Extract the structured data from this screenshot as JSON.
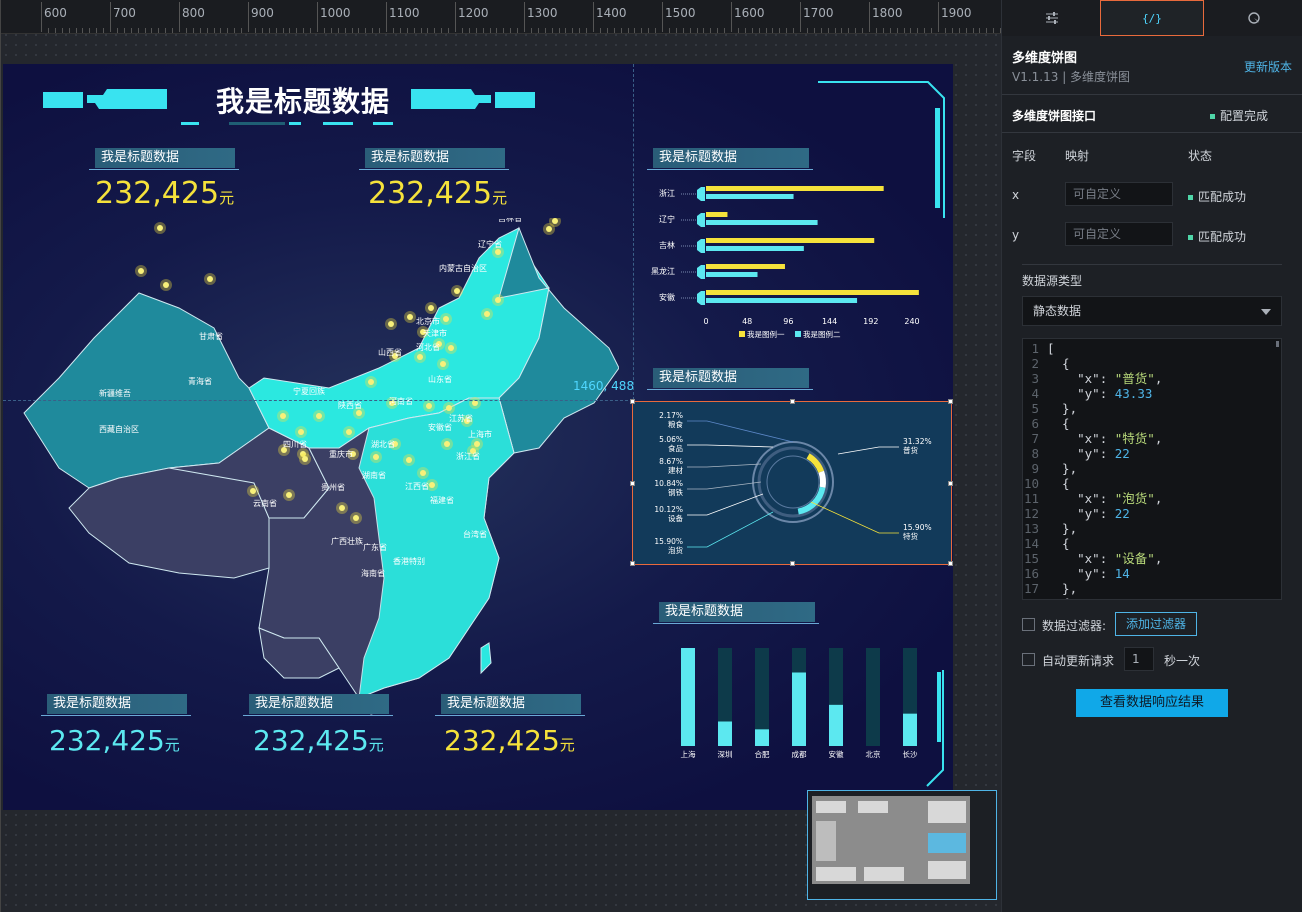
{
  "ruler": {
    "labels": [
      "600",
      "700",
      "800",
      "900",
      "1000",
      "1100",
      "1200",
      "1300",
      "1400",
      "1500",
      "1600",
      "1700",
      "1800",
      "1900"
    ]
  },
  "screen": {
    "main_title": "我是标题数据",
    "cards_top": [
      {
        "title": "我是标题数据",
        "value": "232,425",
        "unit": "元"
      },
      {
        "title": "我是标题数据",
        "value": "232,425",
        "unit": "元"
      }
    ],
    "cards_bottom": [
      {
        "title": "我是标题数据",
        "value": "232,425",
        "unit": "元"
      },
      {
        "title": "我是标题数据",
        "value": "232,425",
        "unit": "元"
      },
      {
        "title": "我是标题数据",
        "value": "232,425",
        "unit": "元"
      }
    ],
    "bar_title": "我是标题数据",
    "pie_title": "我是标题数据",
    "column_title": "我是标题数据",
    "coord_readout": "1460, 488",
    "map_labels": [
      "黑龙江省",
      "吉林省",
      "辽宁省",
      "内蒙古自治区",
      "新疆维吾尔自治区",
      "甘肃省",
      "青海省",
      "西藏自治区",
      "宁夏回族自治区",
      "山西省",
      "北京市",
      "天津市",
      "河北省",
      "山东省",
      "陕西省",
      "河南省",
      "江苏省",
      "上海市",
      "安徽省",
      "四川省",
      "湖北省",
      "重庆市",
      "浙江省",
      "湖南省",
      "江西省",
      "贵州省",
      "福建省",
      "云南省",
      "广西壮族自治区",
      "广东省",
      "台湾省",
      "香港特别行政区",
      "海南省"
    ]
  },
  "chart_data": [
    {
      "type": "bar",
      "orientation": "horizontal",
      "categories": [
        "浙江",
        "辽宁",
        "吉林",
        "黑龙江",
        "安徽"
      ],
      "series": [
        {
          "name": "我是图例一",
          "color": "#f5e23b",
          "values": [
            207,
            25,
            196,
            92,
            248
          ]
        },
        {
          "name": "我是图例二",
          "color": "#5ce8f0",
          "values": [
            102,
            130,
            114,
            60,
            176
          ]
        }
      ],
      "xticks": [
        "0",
        "48",
        "96",
        "144",
        "192",
        "240"
      ],
      "xlim": [
        0,
        240
      ],
      "legend": "bottom"
    },
    {
      "type": "pie",
      "slices": [
        {
          "label": "普货",
          "pct": "31.32%",
          "color": "#ffffff"
        },
        {
          "label": "特货",
          "pct": "15.90%",
          "color": "#f5e23b"
        },
        {
          "label": "泡货",
          "pct": "15.90%",
          "color": "#5ce8f0"
        },
        {
          "label": "设备",
          "pct": "10.12%",
          "color": "#ffffff"
        },
        {
          "label": "钢铁",
          "pct": "10.84%",
          "color": "#aab7c4"
        },
        {
          "label": "建材",
          "pct": "8.67%",
          "color": "#aab7c4"
        },
        {
          "label": "食品",
          "pct": "5.06%",
          "color": "#ffffff"
        },
        {
          "label": "粮食",
          "pct": "2.17%",
          "color": "#5c88c8"
        }
      ]
    },
    {
      "type": "bar",
      "orientation": "vertical",
      "categories": [
        "上海",
        "深圳",
        "合肥",
        "成都",
        "安徽",
        "北京",
        "长沙"
      ],
      "values": [
        100,
        25,
        17,
        75,
        42,
        0,
        33
      ],
      "ylim": [
        0,
        100
      ],
      "color": "#5ce8f0"
    }
  ],
  "panel": {
    "tabs": [
      "style",
      "data",
      "interaction"
    ],
    "component_name": "多维度饼图",
    "version_line": "V1.1.13 | 多维度饼图",
    "update_link": "更新版本",
    "interface_title": "多维度饼图接口",
    "config_status": "配置完成",
    "col_field": "字段",
    "col_map": "映射",
    "col_status": "状态",
    "fields": [
      {
        "name": "x",
        "placeholder": "可自定义",
        "status": "匹配成功"
      },
      {
        "name": "y",
        "placeholder": "可自定义",
        "status": "匹配成功"
      }
    ],
    "source_type_label": "数据源类型",
    "source_type_value": "静态数据",
    "code_lines": [
      "[",
      "  {",
      "    \"x\": \"普货\",",
      "    \"y\": 43.33",
      "  },",
      "  {",
      "    \"x\": \"特货\",",
      "    \"y\": 22",
      "  },",
      "  {",
      "    \"x\": \"泡货\",",
      "    \"y\": 22",
      "  },",
      "  {",
      "    \"x\": \"设备\",",
      "    \"y\": 14",
      "  },",
      "  {"
    ],
    "filter_label": "数据过滤器:",
    "add_filter": "添加过滤器",
    "auto_update_label": "自动更新请求",
    "auto_update_value": "1",
    "auto_update_unit": "秒一次",
    "view_result": "查看数据响应结果"
  }
}
